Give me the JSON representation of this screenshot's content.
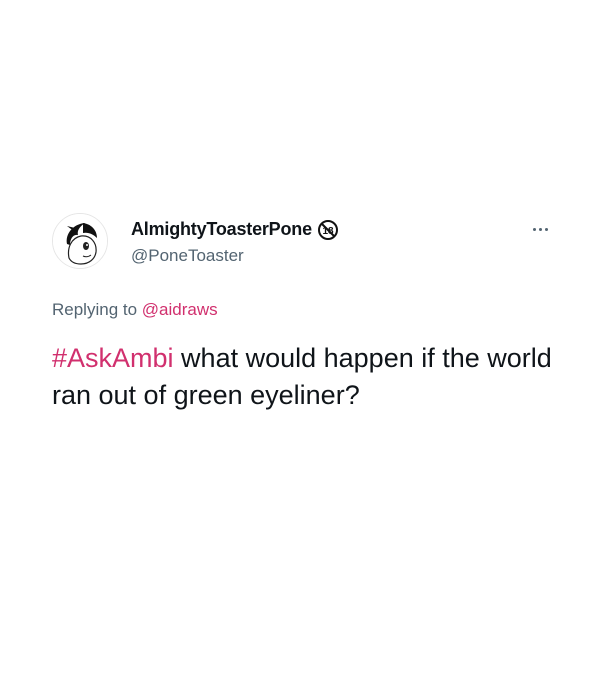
{
  "tweet": {
    "display_name": "AlmightyToasterPone",
    "handle": "@PoneToaster",
    "badge_text": "18",
    "replying_prefix": "Replying to ",
    "replying_mention": "@aidraws",
    "hashtag": "#AskAmbi",
    "body_text": " what would happen if the world ran out of green eyeliner?",
    "more_icon": "more-horizontal-icon"
  },
  "colors": {
    "accent": "#d1306e",
    "text_primary": "#0f1419",
    "text_secondary": "#536471",
    "background": "#ffffff"
  }
}
